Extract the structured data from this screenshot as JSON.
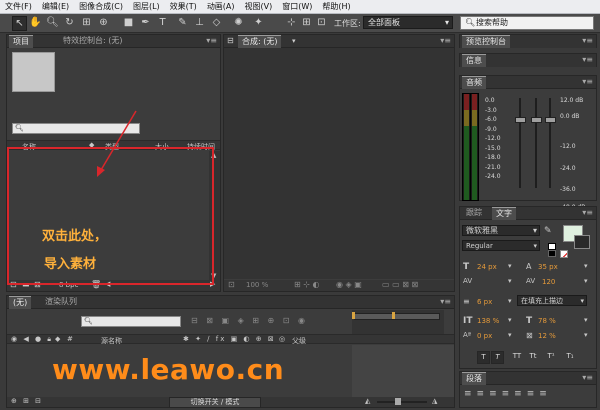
{
  "menu": [
    "文件(F)",
    "编辑(E)",
    "图像合成(C)",
    "图层(L)",
    "效果(T)",
    "动画(A)",
    "视图(V)",
    "窗口(W)",
    "帮助(H)"
  ],
  "toolbar": {
    "workspace_label": "工作区:",
    "workspace_value": "全部面板",
    "search_help": "搜索帮助"
  },
  "project_panel": {
    "tabs": [
      "项目",
      "特效控制台: (无)"
    ],
    "columns": [
      "名称",
      "类型",
      "大小",
      "持续时间"
    ],
    "bpc": "8 bpc"
  },
  "comp_panel": {
    "tab": "合成: (无)",
    "zoom": "100 %"
  },
  "preview_panel": {
    "tab": "预览控制台"
  },
  "info_panel": {
    "tab": "信息"
  },
  "audio_panel": {
    "tab": "音频",
    "left_scale": [
      "0.0",
      "-3.0",
      "-6.0",
      "-9.0",
      "-12.0",
      "-15.0",
      "-18.0",
      "-21.0",
      "-24.0"
    ],
    "right_scale": [
      "12.0 dB",
      "0.0 dB",
      "-12.0",
      "-24.0",
      "-36.0",
      "-48.0 dB"
    ]
  },
  "text_panel": {
    "tabs": [
      "跟踪",
      "文字"
    ],
    "font": "微软雅黑",
    "style": "Regular",
    "size": "24 px",
    "leading": "35 px",
    "tracking": "120",
    "stroke_width": "6 px",
    "stroke_mode": "在填充上描边",
    "vscale": "138 %",
    "hscale": "78 %",
    "baseline": "0 px",
    "tsume": "12 %",
    "style_buttons": [
      "T",
      "T",
      "TT",
      "Tt",
      "T¹",
      "T₁"
    ]
  },
  "paragraph_panel": {
    "tab": "段落"
  },
  "timeline": {
    "tabs": [
      "(无)",
      "渲染队列"
    ],
    "col_source": "源名称",
    "col_parent": "父级",
    "bottom_button": "切换开关 / 模式"
  },
  "annotation": {
    "line1": "双击此处，",
    "line2": "导入素材"
  },
  "watermark": "www.leawo.cn",
  "colors": {
    "annotation_red": "#d9262b",
    "annotation_text": "#ffb13b",
    "watermark": "#ff8c1a"
  }
}
